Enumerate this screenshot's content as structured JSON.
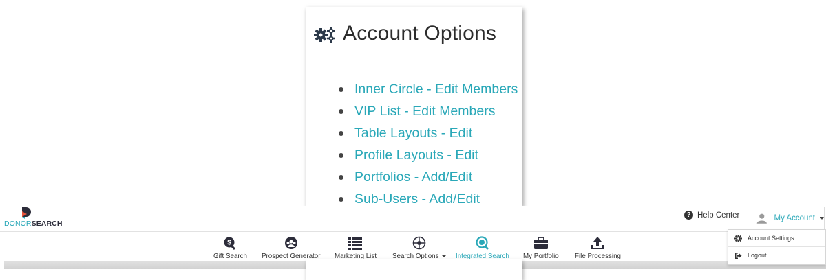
{
  "card": {
    "title": "Account Options",
    "items": [
      "Inner Circle - Edit Members",
      "VIP List - Edit Members",
      "Table Layouts - Edit",
      "Profile Layouts - Edit",
      "Portfolios - Add/Edit",
      "Sub-Users - Add/Edit"
    ]
  },
  "logo": {
    "part1": "DONOR",
    "part2": "SEARCH"
  },
  "header": {
    "help_label": "Help Center",
    "account_label": "My Account"
  },
  "nav": {
    "items": [
      {
        "label": "Gift Search",
        "icon": "gift-search-icon"
      },
      {
        "label": "Prospect Generator",
        "icon": "prospect-generator-icon"
      },
      {
        "label": "Marketing List",
        "icon": "list-icon"
      },
      {
        "label": "Search Options",
        "icon": "search-options-icon"
      },
      {
        "label": "Integrated Search",
        "icon": "integrated-search-icon",
        "active": true
      },
      {
        "label": "My Portfolio",
        "icon": "briefcase-icon"
      },
      {
        "label": "File Processing",
        "icon": "upload-icon"
      }
    ]
  },
  "dropdown": {
    "items": [
      {
        "label": "Account Settings",
        "icon": "gear-icon"
      },
      {
        "label": "Logout",
        "icon": "logout-icon"
      }
    ]
  },
  "colors": {
    "accent": "#2aa8b8",
    "text": "#333333"
  }
}
